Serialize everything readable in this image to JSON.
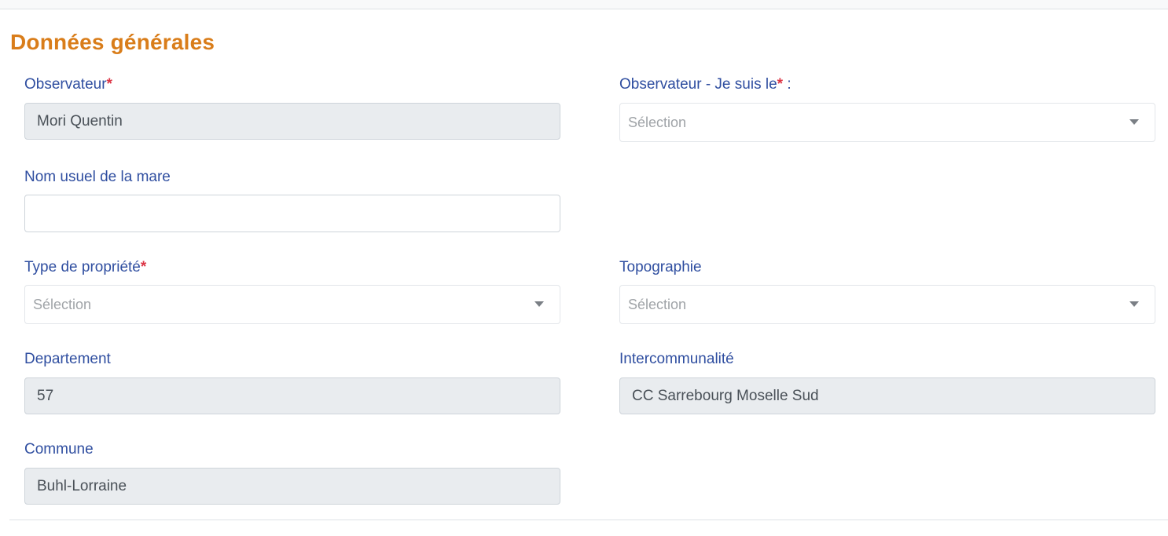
{
  "section": {
    "title": "Données générales"
  },
  "fields": {
    "observateur": {
      "label": "Observateur",
      "required_mark": "*",
      "value": "Mori Quentin"
    },
    "observateur_role": {
      "label": "Observateur - Je suis le",
      "required_mark": "*",
      "suffix": " :",
      "placeholder": "Sélection"
    },
    "nom_usuel": {
      "label": "Nom usuel de la mare",
      "value": ""
    },
    "type_propriete": {
      "label": "Type de propriété",
      "required_mark": "*",
      "placeholder": "Sélection"
    },
    "topographie": {
      "label": "Topographie",
      "placeholder": "Sélection"
    },
    "departement": {
      "label": "Departement",
      "value": "57"
    },
    "intercommunalite": {
      "label": "Intercommunalité",
      "value": "CC Sarrebourg Moselle Sud"
    },
    "commune": {
      "label": "Commune",
      "value": "Buhl-Lorraine"
    }
  },
  "colors": {
    "title": "#d97d1a",
    "label": "#2f4ea0",
    "required": "#dc3545",
    "readonly_bg": "#e9ecef"
  },
  "icons": {
    "select_arrow": "caret-down-icon"
  }
}
